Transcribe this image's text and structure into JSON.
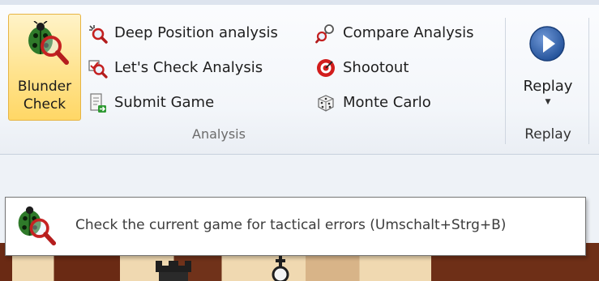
{
  "ribbon": {
    "blunder_check": {
      "label": "Blunder\nCheck",
      "icon": "ladybug-magnifier-icon"
    },
    "items": [
      {
        "label": "Deep Position analysis",
        "icon": "deep-search-icon"
      },
      {
        "label": "Let's Check Analysis",
        "icon": "check-magnifier-icon"
      },
      {
        "label": "Submit Game",
        "icon": "submit-document-icon"
      },
      {
        "label": "Compare Analysis",
        "icon": "compare-magnifiers-icon"
      },
      {
        "label": "Shootout",
        "icon": "shootout-target-icon"
      },
      {
        "label": "Monte Carlo",
        "icon": "dice-icon"
      }
    ],
    "group_label": "Analysis",
    "replay": {
      "label": "Replay",
      "icon": "play-circle-icon",
      "group_label": "Replay"
    }
  },
  "tooltip": {
    "icon": "ladybug-magnifier-icon",
    "text": "Check the current game for tactical errors (Umschalt+Strg+B)"
  },
  "colors": {
    "highlight": "#ffd766",
    "replay_button": "#2f5fa8",
    "shootout_red": "#d21c1c"
  }
}
